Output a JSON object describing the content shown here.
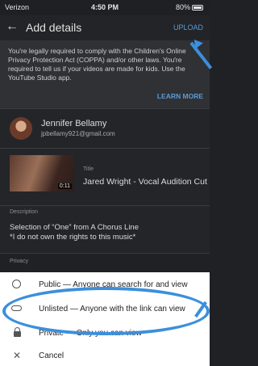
{
  "status_bar": {
    "carrier": "Verizon",
    "time": "4:50 PM",
    "battery": "80%"
  },
  "app_bar": {
    "title": "Add details",
    "upload_label": "UPLOAD"
  },
  "notice": {
    "text": "You're legally required to comply with the Children's Online Privacy Protection Act (COPPA) and/or other laws. You're required to tell us if your videos are made for kids. Use the YouTube Studio app.",
    "learn_more": "LEARN MORE"
  },
  "account": {
    "name": "Jennifer Bellamy",
    "email": "jpbellamy921@gmail.com"
  },
  "video": {
    "duration": "0:11",
    "title_label": "Title",
    "title_value": "Jared Wright - Vocal Audition Cut"
  },
  "description": {
    "label": "Description",
    "line1": "Selection of “One” from A Chorus Line",
    "line2": "*I do not own the rights to this music*"
  },
  "privacy": {
    "label": "Privacy"
  },
  "sheet": {
    "options": [
      {
        "icon": "globe-icon",
        "label": "Public — Anyone can search for and view"
      },
      {
        "icon": "link-icon",
        "label": "Unlisted — Anyone with the link can view"
      },
      {
        "icon": "lock-icon",
        "label": "Private — Only you can view"
      }
    ],
    "cancel_label": "Cancel"
  },
  "colors": {
    "accent": "#5b9bd8",
    "annotation": "#3c8fdc"
  }
}
